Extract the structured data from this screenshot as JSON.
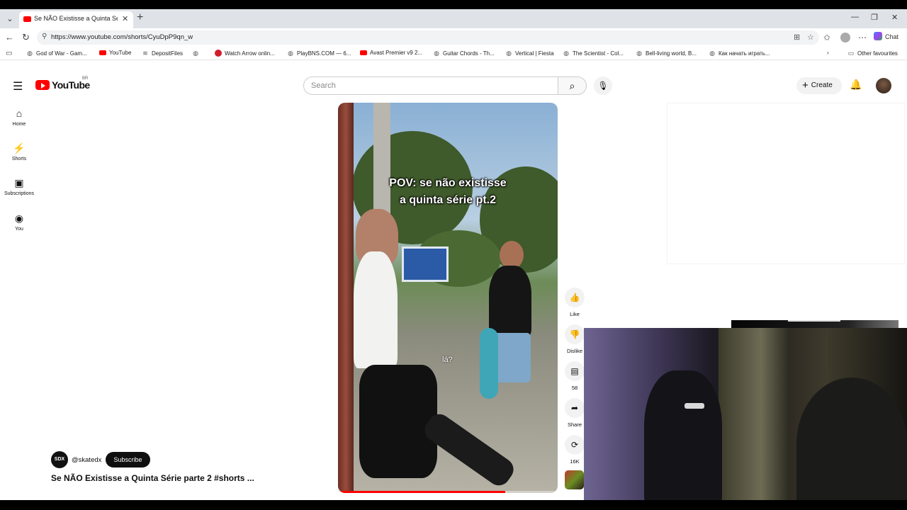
{
  "browser": {
    "tab_title": "Se NÃO Existisse a Quinta Série pa",
    "url": "https://www.youtube.com/shorts/CyuDpP9qn_w",
    "chat_label": "Chat",
    "bookmarks": [
      {
        "label": "God of War - Gam...",
        "icon": "globe-icon"
      },
      {
        "label": "YouTube",
        "icon": "youtube-icon"
      },
      {
        "label": "DepositFiles",
        "icon": "depositfiles-icon"
      },
      {
        "label": "",
        "icon": "globe-icon"
      },
      {
        "label": "Watch Arrow onlin...",
        "icon": "red-icon"
      },
      {
        "label": "PlayBNS.COM — 6...",
        "icon": "globe-icon"
      },
      {
        "label": "Avast Premier v9 2...",
        "icon": "youtube-icon"
      },
      {
        "label": "Guitar Chords - Th...",
        "icon": "globe-icon"
      },
      {
        "label": "Vertical | Fiesta",
        "icon": "globe-icon"
      },
      {
        "label": "The Scientist - Col...",
        "icon": "globe-icon"
      },
      {
        "label": "Bell-living world, B...",
        "icon": "globe-icon"
      },
      {
        "label": "Как начать играть...",
        "icon": "globe-icon"
      }
    ],
    "other_favourites": "Other favourites"
  },
  "youtube": {
    "logo_text": "YouTube",
    "logo_region": "BR",
    "search_placeholder": "Search",
    "create_label": "Create",
    "sidebar": [
      {
        "label": "Home",
        "icon": "home-icon"
      },
      {
        "label": "Shorts",
        "icon": "shorts-icon"
      },
      {
        "label": "Subscriptions",
        "icon": "subscriptions-icon"
      },
      {
        "label": "You",
        "icon": "you-icon"
      }
    ],
    "short": {
      "overlay_line1": "POV: se não existisse",
      "overlay_line2": "a quinta série pt.2",
      "overlay_caption": "lá?",
      "progress": 0.76,
      "actions": {
        "like": "Like",
        "dislike": "Dislike",
        "comments": "58",
        "share": "Share",
        "remix": "16K"
      },
      "channel_handle": "@skatedx",
      "channel_avatar_text": "SDX",
      "subscribe_label": "Subscribe",
      "title": "Se NÃO Existisse a Quinta Série parte 2 #shorts ..."
    }
  }
}
